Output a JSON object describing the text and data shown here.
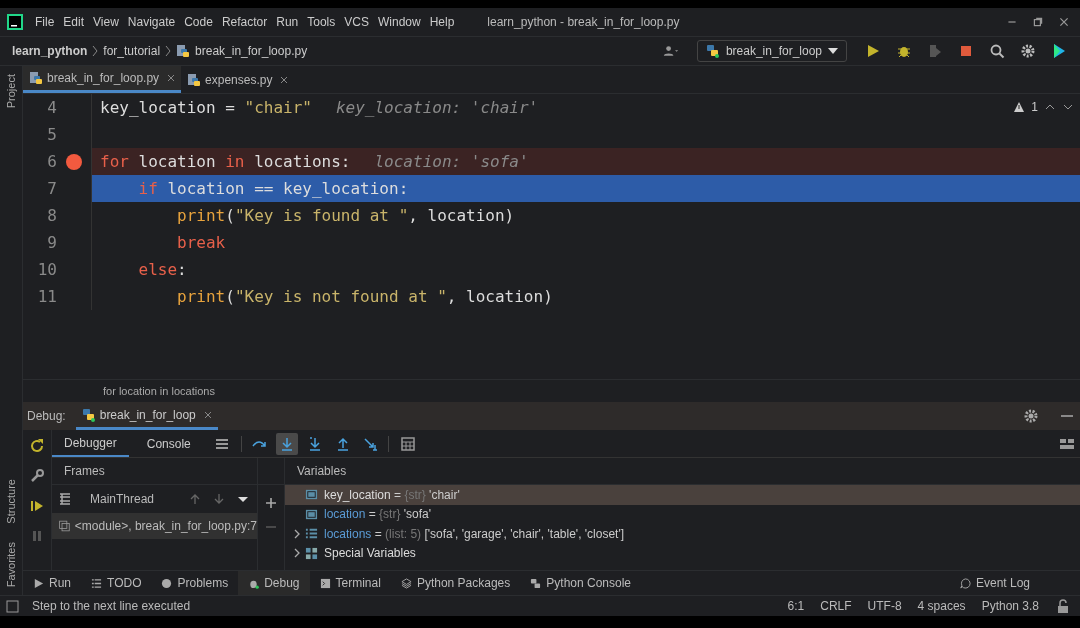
{
  "menu": [
    "File",
    "Edit",
    "View",
    "Navigate",
    "Code",
    "Refactor",
    "Run",
    "Tools",
    "VCS",
    "Window",
    "Help"
  ],
  "window": {
    "title": "learn_python - break_in_for_loop.py"
  },
  "breadcrumbs": [
    "learn_python",
    "for_tutorial",
    "break_in_for_loop.py"
  ],
  "run_config": "break_in_for_loop",
  "editor_tabs": [
    {
      "label": "break_in_for_loop.py",
      "selected": true
    },
    {
      "label": "expenses.py",
      "selected": false
    }
  ],
  "side_left": [
    "Project",
    "Structure",
    "Favorites"
  ],
  "warnings": "1",
  "code": [
    {
      "number": "4",
      "breakpoint": false,
      "current": false,
      "tokens": [
        {
          "kind": "name",
          "text": "key_location = "
        },
        {
          "kind": "string",
          "text": "\"chair\""
        },
        {
          "kind": "hint",
          "text": "key_location: 'chair'"
        }
      ]
    },
    {
      "number": "5",
      "breakpoint": false,
      "current": false
    },
    {
      "number": "6",
      "breakpoint": true,
      "current": false,
      "tokens": [
        {
          "kind": "keyword",
          "text": "for "
        },
        {
          "kind": "name",
          "text": "location "
        },
        {
          "kind": "keyword",
          "text": "in "
        },
        {
          "kind": "name",
          "text": "locations:"
        },
        {
          "kind": "hint",
          "text": "location: 'sofa'"
        }
      ]
    },
    {
      "number": "7",
      "breakpoint": false,
      "current": true,
      "tokens": [
        {
          "kind": "keyword",
          "text": "    if "
        },
        {
          "kind": "name",
          "text": "location == key_location:"
        }
      ]
    },
    {
      "number": "8",
      "breakpoint": false,
      "current": false,
      "tokens": [
        {
          "kind": "builtin",
          "text": "        print"
        },
        {
          "kind": "name",
          "text": "("
        },
        {
          "kind": "string",
          "text": "\"Key is found at \""
        },
        {
          "kind": "name",
          "text": ", location)"
        }
      ]
    },
    {
      "number": "9",
      "breakpoint": false,
      "current": false,
      "tokens": [
        {
          "kind": "keyword",
          "text": "        break"
        }
      ]
    },
    {
      "number": "10",
      "breakpoint": false,
      "current": false,
      "tokens": [
        {
          "kind": "keyword",
          "text": "    else"
        },
        {
          "kind": "name",
          "text": ":"
        }
      ]
    },
    {
      "number": "11",
      "breakpoint": false,
      "current": false,
      "tokens": [
        {
          "kind": "builtin",
          "text": "        print"
        },
        {
          "kind": "name",
          "text": "("
        },
        {
          "kind": "string",
          "text": "\"Key is not found at \""
        },
        {
          "kind": "name",
          "text": ", location)"
        }
      ]
    }
  ],
  "editor_breadcrumb": "for location in locations",
  "debug": {
    "label": "Debug:",
    "session": "break_in_for_loop",
    "tabs": [
      {
        "label": "Debugger",
        "selected": true
      },
      {
        "label": "Console",
        "selected": false
      }
    ],
    "step_buttons": [
      {
        "kind": "step-over",
        "active": false
      },
      {
        "kind": "step-into",
        "active": true
      },
      {
        "kind": "step-into-my",
        "active": false
      },
      {
        "kind": "step-out",
        "active": false
      },
      {
        "kind": "run-to-cursor",
        "active": false
      }
    ],
    "frames_title": "Frames",
    "variables_title": "Variables",
    "thread": "MainThread",
    "frames": [
      {
        "label": "<module>, break_in_for_loop.py:7",
        "selected": true
      }
    ],
    "variables": [
      {
        "kind": "str",
        "expandable": false,
        "selected": true,
        "changed": false,
        "name": "key_location",
        "operator": "=",
        "type": "{str}",
        "value": "'chair'"
      },
      {
        "kind": "str",
        "expandable": false,
        "selected": false,
        "changed": true,
        "name": "location",
        "operator": "=",
        "type": "{str}",
        "value": "'sofa'"
      },
      {
        "kind": "list",
        "expandable": true,
        "selected": false,
        "changed": true,
        "name": "locations",
        "operator": "=",
        "type": "(list: 5)",
        "value": "['sofa', 'garage', 'chair', 'table', 'closet']"
      },
      {
        "kind": "special",
        "expandable": true,
        "selected": false,
        "changed": false,
        "name": "Special Variables"
      }
    ]
  },
  "tool_tabs": [
    {
      "kind": "run",
      "label": "Run",
      "selected": false
    },
    {
      "kind": "todo",
      "label": "TODO",
      "selected": false
    },
    {
      "kind": "problems",
      "label": "Problems",
      "selected": false
    },
    {
      "kind": "debug",
      "label": "Debug",
      "selected": true
    },
    {
      "kind": "terminal",
      "label": "Terminal",
      "selected": false
    },
    {
      "kind": "packages",
      "label": "Python Packages",
      "selected": false
    },
    {
      "kind": "console",
      "label": "Python Console",
      "selected": false
    }
  ],
  "event_log": "Event Log",
  "status_bar": {
    "message": "Step to the next line executed",
    "items": [
      "6:1",
      "CRLF",
      "UTF-8",
      "4 spaces",
      "Python 3.8"
    ]
  }
}
